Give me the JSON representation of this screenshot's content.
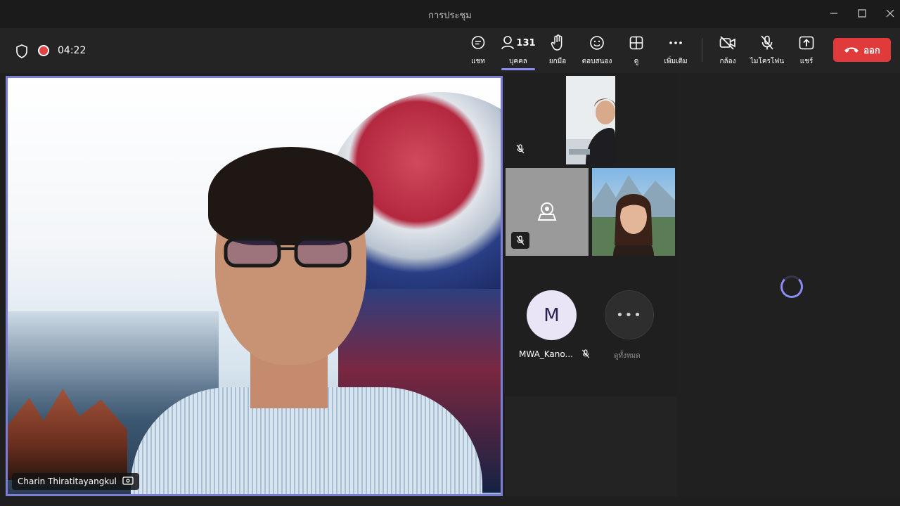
{
  "window": {
    "title": "การประชุม"
  },
  "toolbar": {
    "timer": "04:22",
    "buttons": {
      "chat": {
        "label": "แชท",
        "icon": "chat-icon"
      },
      "people": {
        "label": "บุคคล",
        "count": "131",
        "icon": "people-icon"
      },
      "raise_hand": {
        "label": "ยกมือ",
        "icon": "hand-icon"
      },
      "react": {
        "label": "ตอบสนอง",
        "icon": "smiley-icon"
      },
      "view": {
        "label": "ดู",
        "icon": "grid-icon"
      },
      "more": {
        "label": "เพิ่มเติม",
        "icon": "more-icon"
      },
      "camera": {
        "label": "กล้อง",
        "icon": "camera-off-icon"
      },
      "mic": {
        "label": "ไมโครโฟน",
        "icon": "mic-off-icon"
      },
      "share": {
        "label": "แชร์",
        "icon": "share-icon"
      }
    },
    "leave_label": "ออก"
  },
  "main_video": {
    "speaker_name": "Charin Thiratitayangkul"
  },
  "participants": {
    "avatar_initial": "M",
    "avatar_name": "MWA_Kano...",
    "view_all_label": "ดูทั้งหมด"
  },
  "colors": {
    "accent": "#8b8cf6",
    "leave": "#e03a3a",
    "recording": "#e04343",
    "background": "#1f1f1f"
  }
}
